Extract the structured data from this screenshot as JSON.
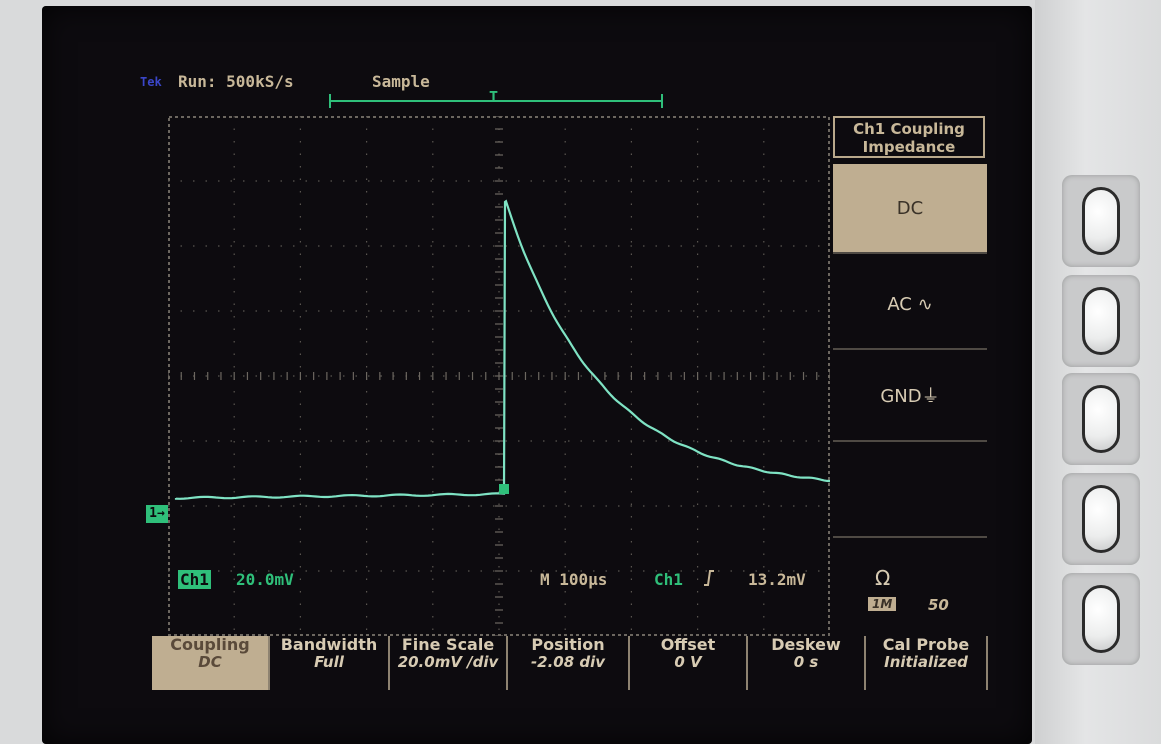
{
  "status": {
    "mode": "Tek",
    "run": "Run: 500kS/s",
    "acq": "Sample",
    "trigger_marker": "T"
  },
  "readout": {
    "channel": "Ch1",
    "volts_div": "20.0mV",
    "timebase": "M 100µs",
    "trigger_source": "Ch1",
    "trigger_slope_icon": "rising-edge-icon",
    "trigger_level": "13.2mV",
    "ground_marker": "1→"
  },
  "side_menu": {
    "title_line1": "Ch1 Coupling",
    "title_line2": "Impedance",
    "items": [
      {
        "label": "DC",
        "selected": true
      },
      {
        "label": "AC ∿",
        "selected": false
      },
      {
        "label": "GND⏚",
        "selected": false
      }
    ],
    "impedance_symbol": "Ω",
    "impedance_tag": "1M",
    "impedance_alt": "50"
  },
  "bottom_menu": [
    {
      "label": "Coupling",
      "value": "DC",
      "selected": true
    },
    {
      "label": "Bandwidth",
      "value": "Full",
      "selected": false
    },
    {
      "label": "Fine Scale",
      "value": "20.0mV /div",
      "selected": false
    },
    {
      "label": "Position",
      "value": "-2.08 div",
      "selected": false
    },
    {
      "label": "Offset",
      "value": "0 V",
      "selected": false
    },
    {
      "label": "Deskew",
      "value": "0 s",
      "selected": false
    },
    {
      "label": "Cal Probe",
      "value": "Initialized",
      "selected": false
    }
  ],
  "colors": {
    "trace": "#7fe3c4",
    "accent": "#2fbf7a",
    "menu_text": "#d7cbb3",
    "menu_selected_bg": "#bfae91"
  }
}
